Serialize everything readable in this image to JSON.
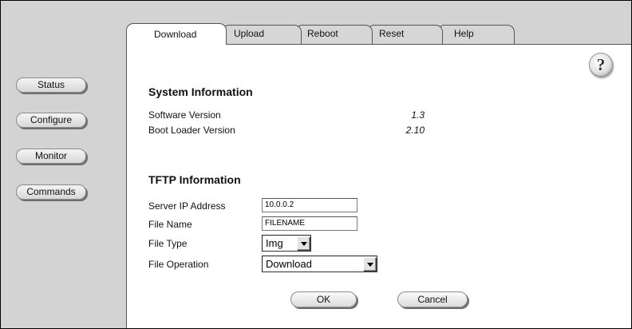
{
  "nav": {
    "status": "Status",
    "configure": "Configure",
    "monitor": "Monitor",
    "commands": "Commands"
  },
  "tabs": {
    "download": "Download",
    "upload": "Upload",
    "reboot": "Reboot",
    "reset": "Reset",
    "help": "Help",
    "active": "Download"
  },
  "help_icon": {
    "glyph": "?",
    "icon": "help-icon"
  },
  "system_info": {
    "title": "System Information",
    "software_label": "Software Version",
    "software_value": "1.3",
    "bootloader_label": "Boot Loader Version",
    "bootloader_value": "2.10"
  },
  "tftp": {
    "title": "TFTP Information",
    "server_ip_label": "Server IP Address",
    "server_ip_value": "10.0.0.2",
    "file_name_label": "File Name",
    "file_name_value": "FILENAME",
    "file_type_label": "File Type",
    "file_type_value": "Img",
    "file_operation_label": "File Operation",
    "file_operation_value": "Download"
  },
  "actions": {
    "ok": "OK",
    "cancel": "Cancel"
  },
  "colors": {
    "background": "#d3d3d3",
    "panel": "#ffffff",
    "border": "#555555"
  }
}
